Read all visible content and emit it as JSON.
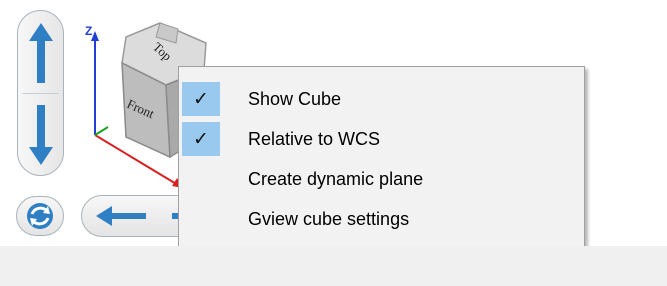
{
  "viewcube": {
    "axis_z_label": "Z",
    "face_top_label": "Top",
    "face_front_label": "Front"
  },
  "nav": {
    "pan_up_icon": "arrow-up-icon",
    "pan_down_icon": "arrow-down-icon",
    "pan_left_icon": "arrow-left-icon",
    "rotate_icon": "rotate-icon"
  },
  "context_menu": {
    "items": [
      {
        "label": "Show Cube",
        "checked": true,
        "check_glyph": "✓"
      },
      {
        "label": "Relative to WCS",
        "checked": true,
        "check_glyph": "✓"
      },
      {
        "label": "Create dynamic plane",
        "checked": false
      },
      {
        "label": "Gview cube settings",
        "checked": false
      }
    ]
  },
  "colors": {
    "arrow_blue": "#2f7fc4",
    "menu_highlight": "#99c9ef",
    "axis_x": "#d92020",
    "axis_y": "#1aa31a",
    "axis_z": "#1f3fd6"
  }
}
